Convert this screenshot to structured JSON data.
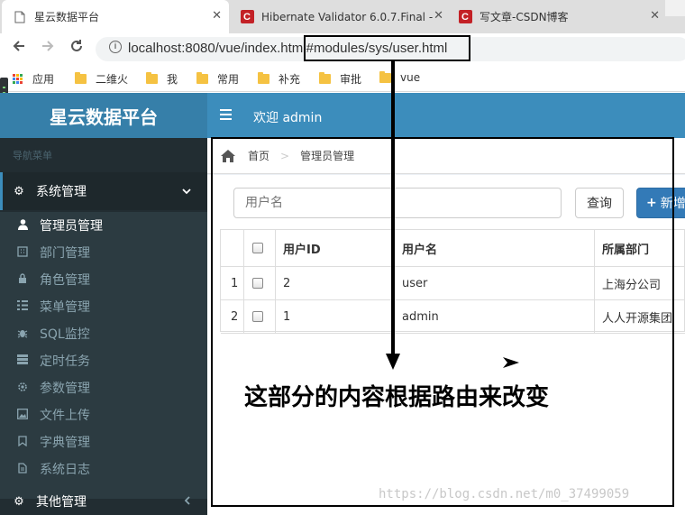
{
  "browser": {
    "tabs": [
      {
        "title": "星云数据平台",
        "active": true
      },
      {
        "title": "Hibernate Validator 6.0.7.Final -",
        "active": false
      },
      {
        "title": "写文章-CSDN博客",
        "active": false
      }
    ],
    "close_glyph": "✕",
    "url": "localhost:8080/vue/index.html#modules/sys/user.html",
    "bookmarks": [
      "应用",
      "二维火",
      "我",
      "常用",
      "补充",
      "审批",
      "vue"
    ]
  },
  "app": {
    "logo": "星云数据平台",
    "welcome": "欢迎 admin",
    "accent_color": "#3c8dbc"
  },
  "sidebar": {
    "header": "导航菜单",
    "groups": [
      {
        "label": "系统管理",
        "icon": "gear-icon",
        "state": "expanded"
      },
      {
        "label": "其他管理",
        "icon": "gear-icon",
        "state": "collapsed"
      }
    ],
    "items": [
      {
        "label": "管理员管理",
        "icon": "user-icon"
      },
      {
        "label": "部门管理",
        "icon": "building-icon"
      },
      {
        "label": "角色管理",
        "icon": "role-icon"
      },
      {
        "label": "菜单管理",
        "icon": "list-icon"
      },
      {
        "label": "SQL监控",
        "icon": "bug-icon"
      },
      {
        "label": "定时任务",
        "icon": "tasks-icon"
      },
      {
        "label": "参数管理",
        "icon": "cog-icon"
      },
      {
        "label": "文件上传",
        "icon": "image-icon"
      },
      {
        "label": "字典管理",
        "icon": "bookmark-icon"
      },
      {
        "label": "系统日志",
        "icon": "file-icon"
      }
    ]
  },
  "breadcrumb": {
    "home": "首页",
    "current": "管理员管理"
  },
  "toolbar": {
    "search_placeholder": "用户名",
    "query_label": "查询",
    "add_label": "新增"
  },
  "table": {
    "columns": [
      "用户ID",
      "用户名",
      "所属部门"
    ],
    "rows": [
      {
        "index": "1",
        "id": "2",
        "username": "user",
        "dept": "上海分公司"
      },
      {
        "index": "2",
        "id": "1",
        "username": "admin",
        "dept": "人人开源集团"
      }
    ]
  },
  "annotation": {
    "text": "这部分的内容根据路由来改变"
  },
  "watermark": "https://blog.csdn.net/m0_37499059"
}
